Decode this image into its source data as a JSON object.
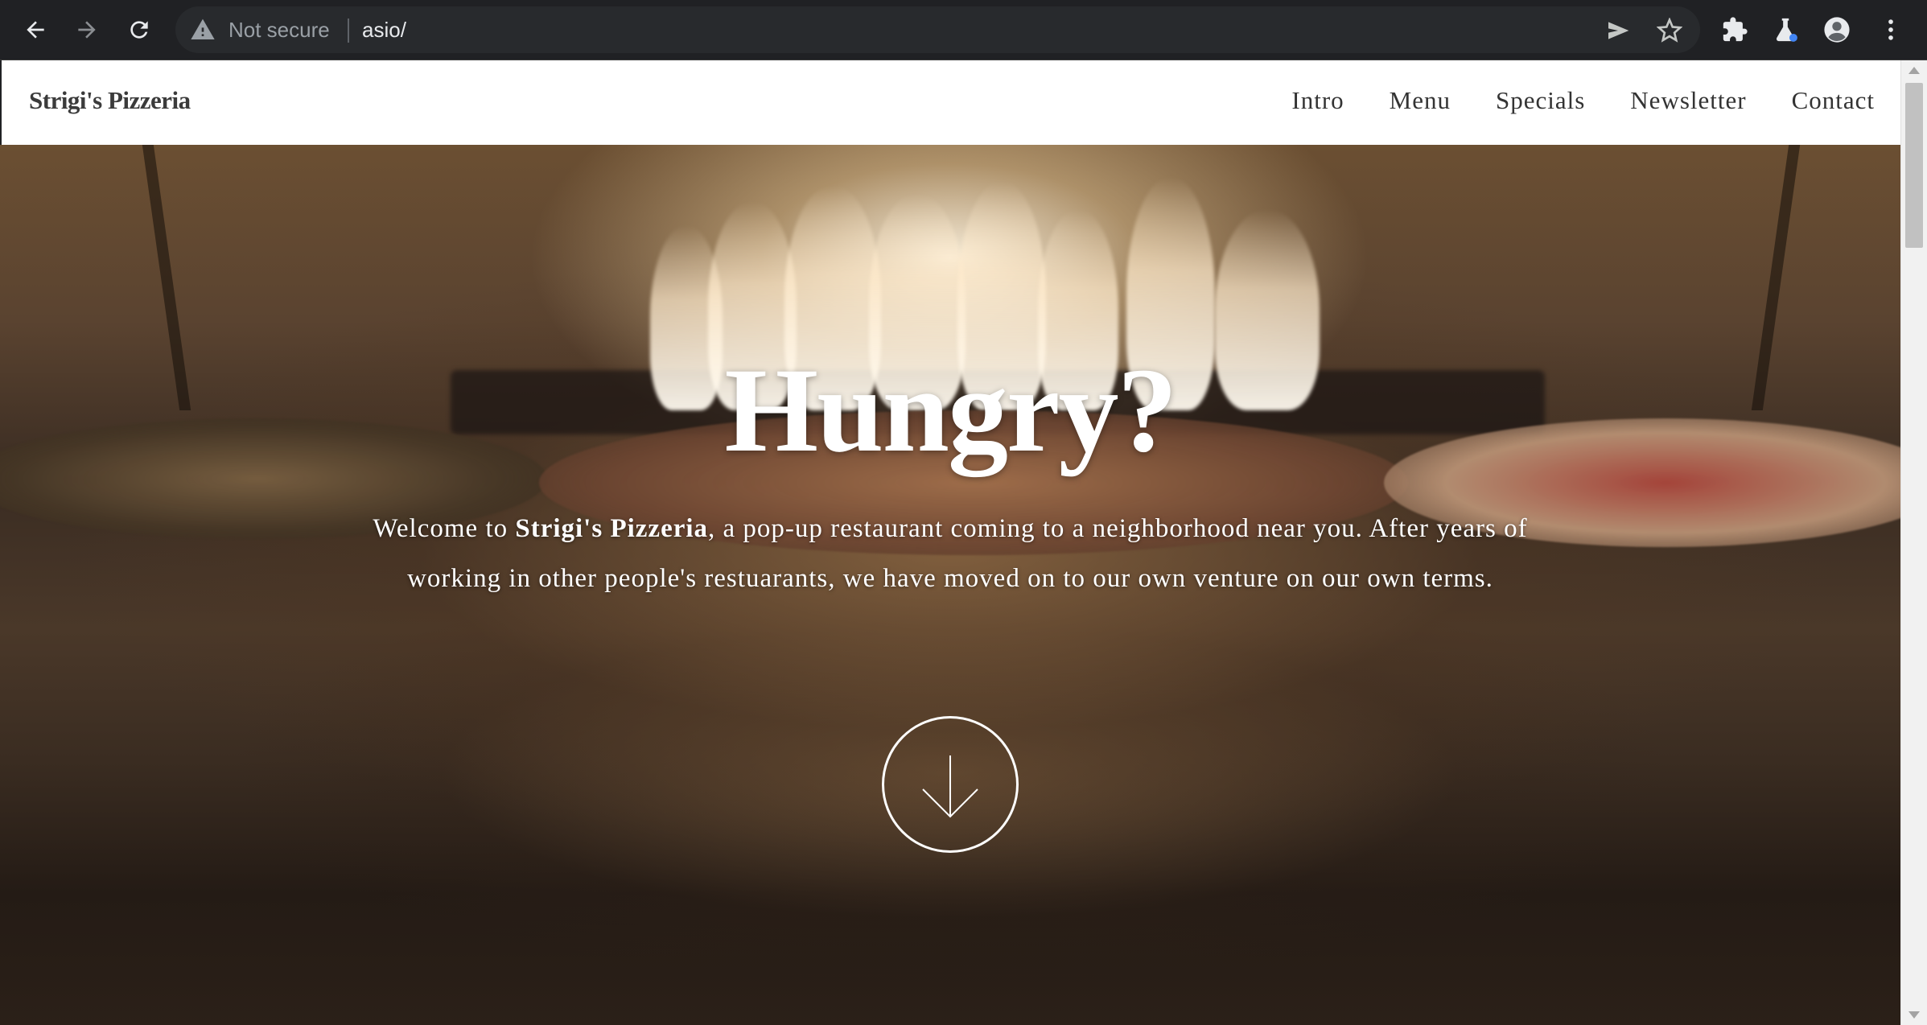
{
  "browser": {
    "security_label": "Not secure",
    "url": "asio/",
    "icons": {
      "back": "back-arrow-icon",
      "forward": "forward-arrow-icon",
      "reload": "reload-icon",
      "warning": "warning-triangle-icon",
      "send": "send-tab-icon",
      "bookmark": "star-icon",
      "extensions": "puzzle-icon",
      "labs": "flask-icon",
      "profile": "account-circle-icon",
      "menu": "kebab-menu-icon"
    }
  },
  "site": {
    "brand": "Strigi's Pizzeria",
    "nav": [
      "Intro",
      "Menu",
      "Specials",
      "Newsletter",
      "Contact"
    ]
  },
  "hero": {
    "title": "Hungry?",
    "intro_prefix": "Welcome to ",
    "intro_brand": "Strigi's Pizzeria",
    "intro_suffix": ", a pop-up restaurant coming to a neighborhood near you. After years of working in other people's restuarants, we have moved on to our own venture on our own terms.",
    "scroll_button_icon": "arrow-down-icon"
  },
  "colors": {
    "chrome_bg": "#202124",
    "omnibox_bg": "#282a2d",
    "nav_text": "#333333",
    "hero_text": "#ffffff"
  }
}
